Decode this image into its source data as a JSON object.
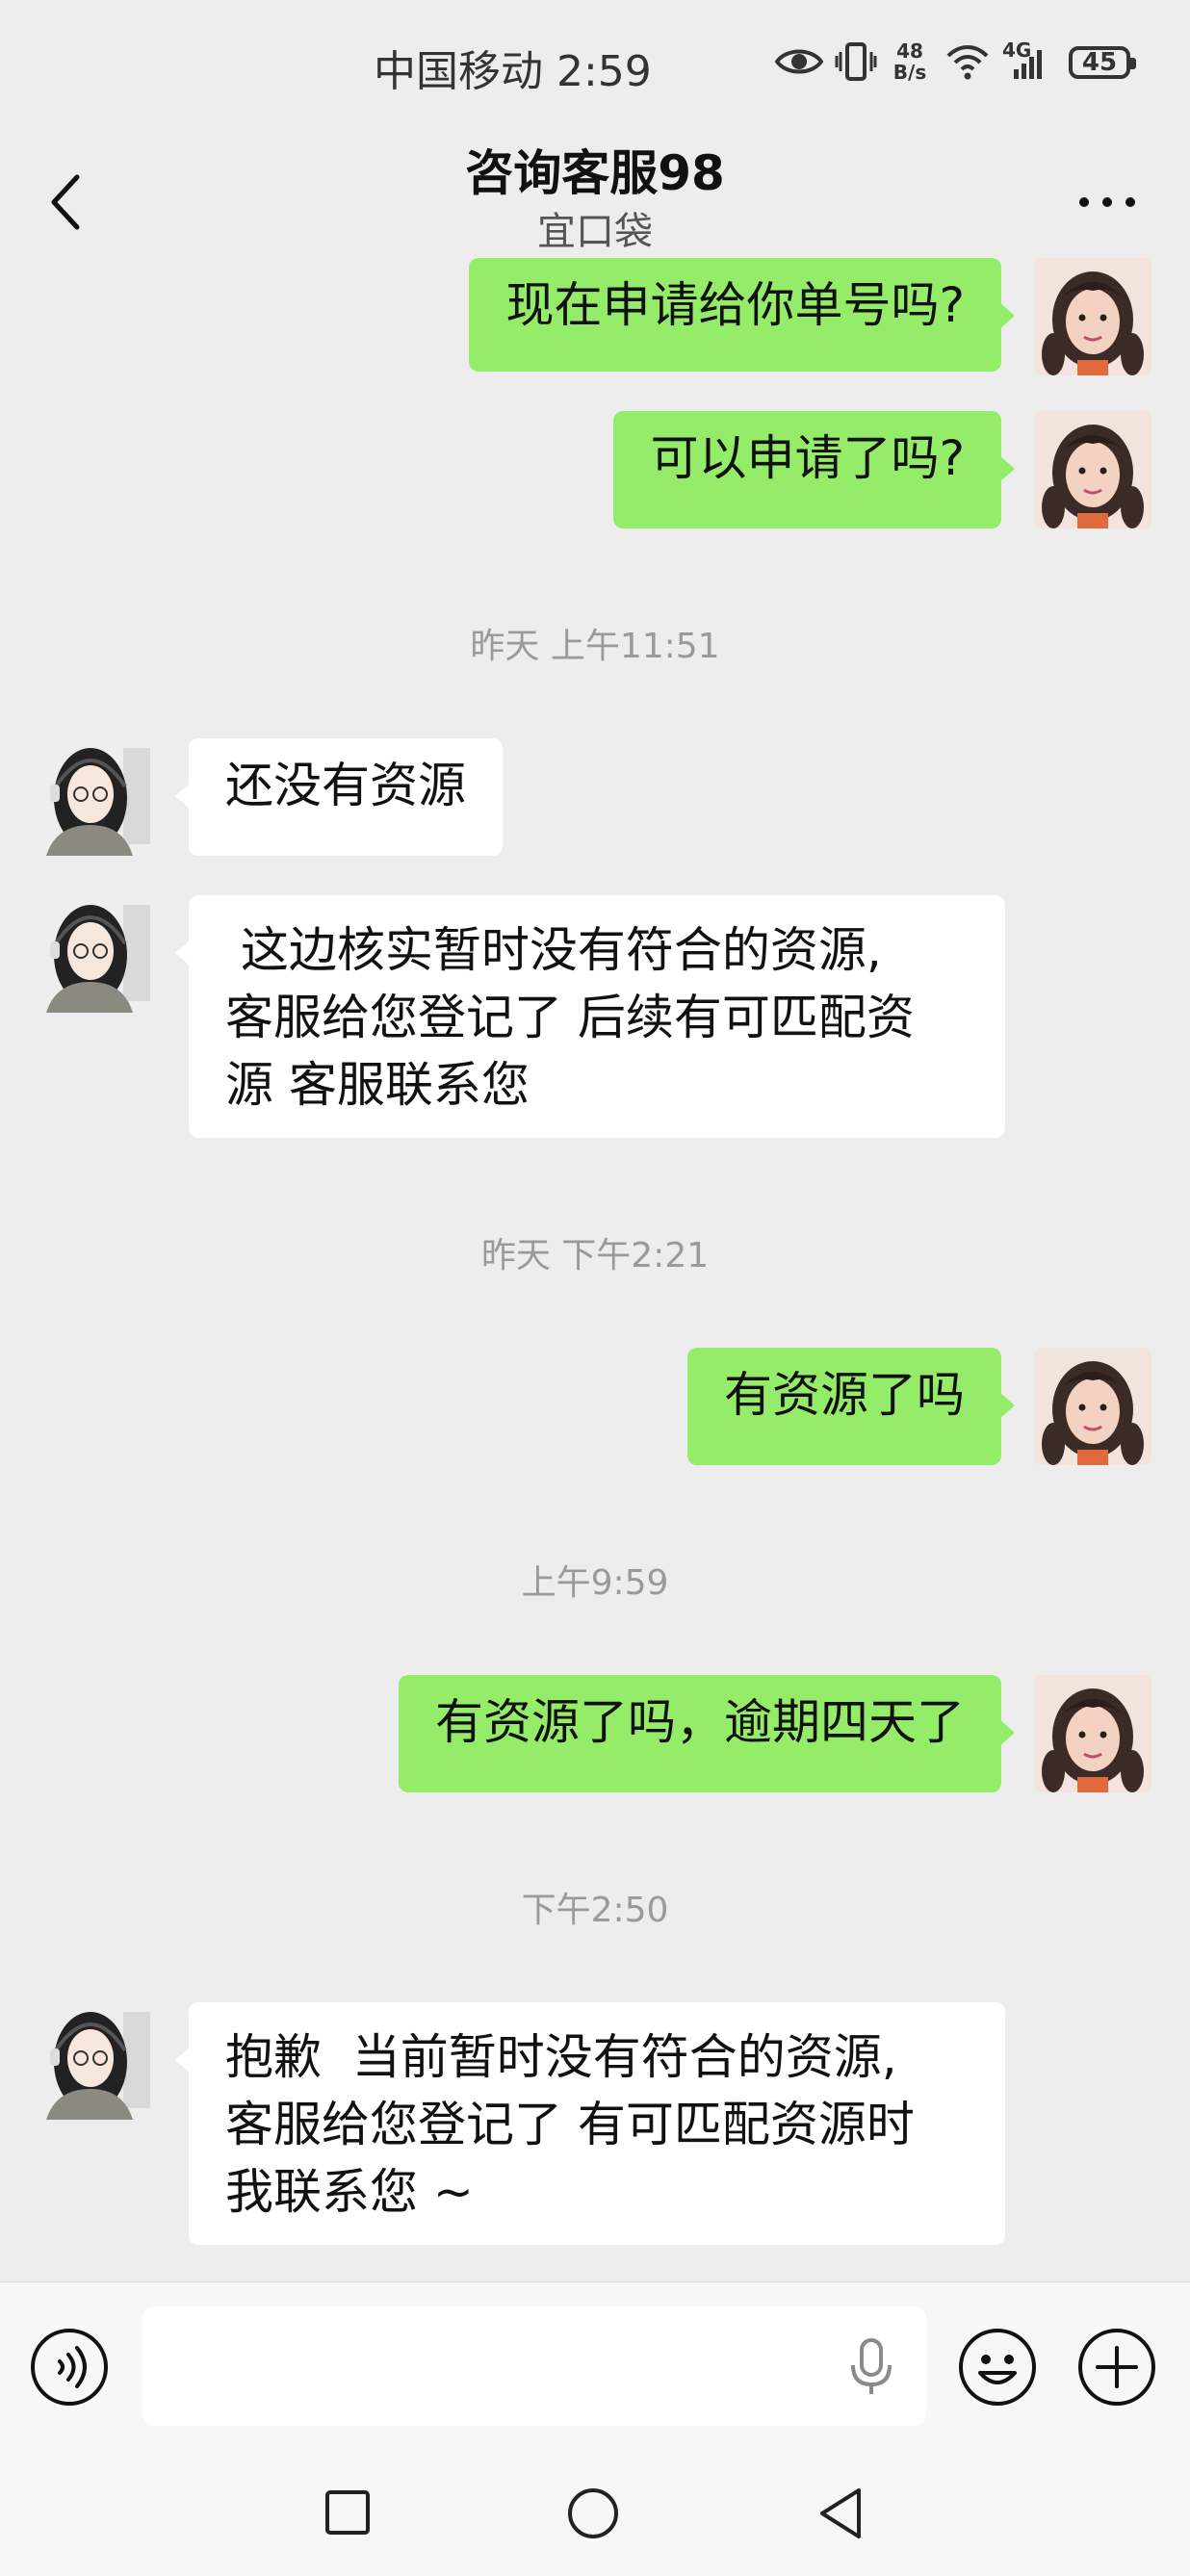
{
  "status_bar": {
    "carrier_time": "中国移动 2:59",
    "net_speed_value": "48",
    "net_speed_unit": "B/s",
    "network_type": "4G",
    "battery": "45"
  },
  "header": {
    "title": "咨询客服98",
    "subtitle": "宜口袋"
  },
  "messages": [
    {
      "side": "me",
      "text": "现在申请给你单号吗?"
    },
    {
      "side": "me",
      "text": "可以申请了吗?"
    },
    {
      "timestamp": "昨天 上午11:51"
    },
    {
      "side": "them",
      "text": "还没有资源"
    },
    {
      "side": "them",
      "lines": [
        " 这边核实暂时没有符合的资源,",
        "客服给您登记了 后续有可匹配资",
        "源 客服联系您"
      ]
    },
    {
      "timestamp": "昨天 下午2:21"
    },
    {
      "side": "me",
      "text": "有资源了吗"
    },
    {
      "timestamp": "上午9:59"
    },
    {
      "side": "me",
      "text": "有资源了吗，逾期四天了"
    },
    {
      "timestamp": "下午2:50"
    },
    {
      "side": "them",
      "lines": [
        "抱歉  当前暂时没有符合的资源,",
        "客服给您登记了 有可匹配资源时",
        "我联系您 ~"
      ]
    }
  ],
  "icons": {
    "back": "chevron-left-icon",
    "more": "more-dots-icon",
    "voice": "voice-icon",
    "mic": "mic-icon",
    "emoji": "emoji-icon",
    "plus": "plus-icon"
  },
  "colors": {
    "background": "#ededed",
    "my_bubble": "#95ec69",
    "their_bubble": "#ffffff"
  }
}
